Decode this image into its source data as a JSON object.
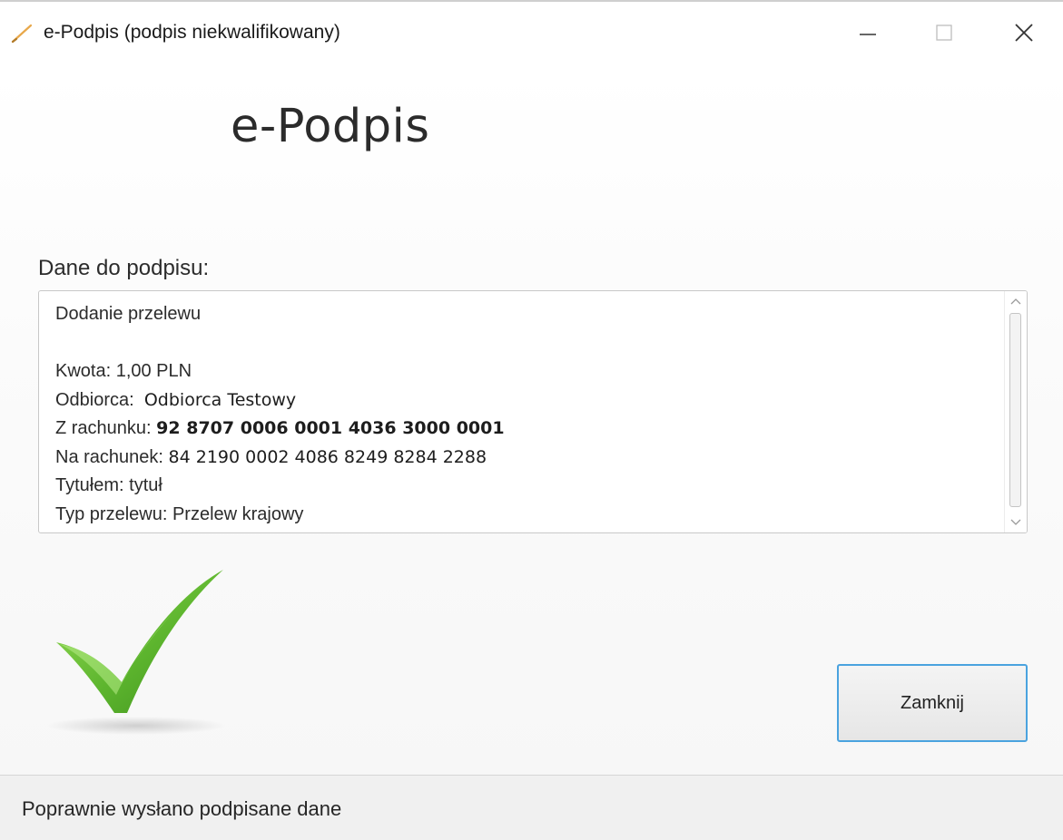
{
  "window": {
    "title": "e-Podpis (podpis niekwalifikowany)",
    "icon": "pen-icon",
    "controls": {
      "minimize": "minimize-icon",
      "maximize": "maximize-icon",
      "close": "close-icon"
    }
  },
  "app": {
    "title": "e-Podpis"
  },
  "signing_data": {
    "label": "Dane do podpisu:",
    "lines": [
      {
        "label": "Dodanie przelewu",
        "value": ""
      },
      {
        "label": "",
        "value": ""
      },
      {
        "label": "Kwota: 1,00 PLN",
        "value": ""
      },
      {
        "label": "Odbiorca:",
        "value": "Odbiorca Testowy"
      },
      {
        "label": "Z rachunku:",
        "value": "92 8707 0006 0001 4036 3000 0001"
      },
      {
        "label": "Na rachunek:",
        "value": "84 2190 0002 4086 8249 8284 2288"
      },
      {
        "label": "Tytułem: tytuł",
        "value": ""
      },
      {
        "label": "Typ przelewu: Przelew krajowy",
        "value": ""
      }
    ]
  },
  "success_icon": "checkmark-icon",
  "buttons": {
    "close_label": "Zamknij"
  },
  "status": {
    "text": "Poprawnie wysłano podpisane dane"
  },
  "colors": {
    "button_border": "#4aa3df",
    "checkmark_green": "#6cc13a"
  }
}
